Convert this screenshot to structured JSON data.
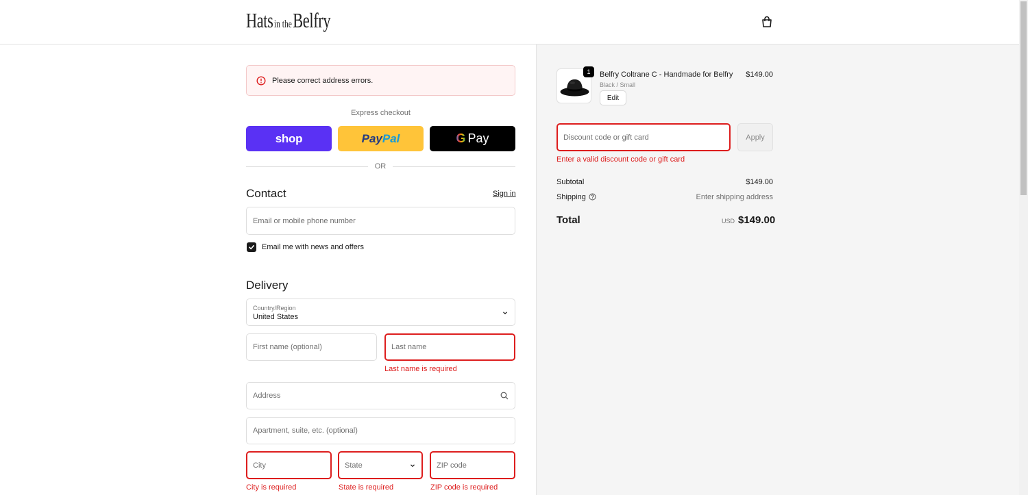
{
  "header": {
    "logo": {
      "word1": "Hats",
      "word2": "in the",
      "word3": "Belfry"
    }
  },
  "alert": {
    "message": "Please correct address errors."
  },
  "express": {
    "label": "Express checkout",
    "shop_label": "shop",
    "paypal_label_1": "Pay",
    "paypal_label_2": "Pal",
    "gpay_g": "G",
    "gpay_label": "Pay",
    "or_label": "OR"
  },
  "contact": {
    "title": "Contact",
    "sign_in": "Sign in",
    "email_placeholder": "Email or mobile phone number",
    "newsletter_label": "Email me with news and offers",
    "newsletter_checked": true
  },
  "delivery": {
    "title": "Delivery",
    "country_label": "Country/Region",
    "country_value": "United States",
    "first_name_placeholder": "First name (optional)",
    "last_name_placeholder": "Last name",
    "last_name_error": "Last name is required",
    "address_placeholder": "Address",
    "apartment_placeholder": "Apartment, suite, etc. (optional)",
    "city_placeholder": "City",
    "city_error": "City is required",
    "state_placeholder": "State",
    "state_error": "State is required",
    "zip_placeholder": "ZIP code",
    "zip_error": "ZIP code is required"
  },
  "order": {
    "product": {
      "quantity": "1",
      "name": "Belfry Coltrane C - Handmade for Belfry",
      "variant": "Black / Small",
      "price": "$149.00",
      "edit_label": "Edit"
    },
    "discount_placeholder": "Discount code or gift card",
    "apply_label": "Apply",
    "discount_error": "Enter a valid discount code or gift card",
    "subtotal_label": "Subtotal",
    "subtotal_value": "$149.00",
    "shipping_label": "Shipping",
    "shipping_value": "Enter shipping address",
    "total_label": "Total",
    "currency": "USD",
    "total_value": "$149.00"
  },
  "colors": {
    "error": "#dd1d1d",
    "shop_pay": "#5a31f4",
    "paypal": "#ffc439",
    "gpay": "#000000"
  }
}
